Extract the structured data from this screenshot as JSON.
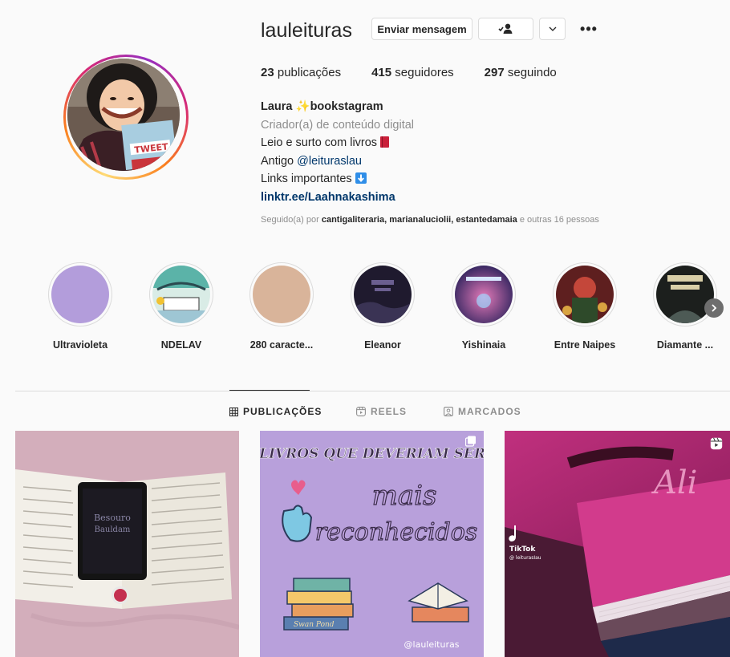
{
  "profile": {
    "username": "lauleituras",
    "message_button": "Enviar mensagem",
    "stats": {
      "posts_count": "23",
      "posts_label": "publicações",
      "followers_count": "415",
      "followers_label": "seguidores",
      "following_count": "297",
      "following_label": "seguindo"
    },
    "bio": {
      "name_part1": "Laura ",
      "name_emoji": "✨",
      "name_part2": "bookstagram",
      "category": "Criador(a) de conteúdo digital",
      "line1": "Leio e surto com livros ",
      "line2_prefix": "Antigo ",
      "line2_mention": "@leituraslau",
      "line3": "Links importantes ",
      "link": "linktr.ee/Laahnakashima"
    },
    "followed_by": {
      "prefix": "Seguido(a) por ",
      "users": "cantigaliteraria, marianaluciolii, estantedamaia",
      "suffix": " e outras 16 pessoas"
    }
  },
  "highlights": [
    {
      "label": "Ultravioleta"
    },
    {
      "label": "NDELAV"
    },
    {
      "label": "280 caracte..."
    },
    {
      "label": "Eleanor"
    },
    {
      "label": "Yishinaia"
    },
    {
      "label": "Entre Naipes"
    },
    {
      "label": "Diamante ..."
    }
  ],
  "tabs": {
    "posts": "PUBLICAÇÕES",
    "reels": "REELS",
    "tagged": "MARCADOS"
  },
  "posts": {
    "p2_title": "LIVROS QUE DEVERIAM SER",
    "p2_line1": "mais",
    "p2_line2": "reconhecidos",
    "p2_handle": "@lauleituras",
    "p2_book": "Swan Pond",
    "p3_brand": "TikTok",
    "p3_user": "@ leiturasIau",
    "p3_cover": "Ali"
  },
  "colors": {
    "link": "#00376b",
    "muted": "#8e8e8e",
    "text": "#262626",
    "purple": "#b8a0db"
  }
}
